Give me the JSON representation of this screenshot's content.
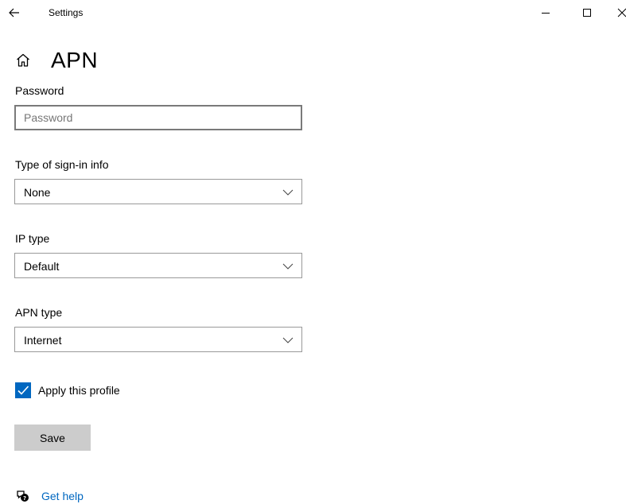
{
  "window": {
    "title": "Settings",
    "back_icon": "arrow-left-icon",
    "minimize_icon": "minimize-icon",
    "maximize_icon": "maximize-icon",
    "close_icon": "close-icon"
  },
  "header": {
    "home_icon": "home-icon",
    "title": "APN"
  },
  "form": {
    "password": {
      "label": "Password",
      "placeholder": "Password",
      "value": ""
    },
    "sign_in_type": {
      "label": "Type of sign-in info",
      "value": "None"
    },
    "ip_type": {
      "label": "IP type",
      "value": "Default"
    },
    "apn_type": {
      "label": "APN type",
      "value": "Internet"
    },
    "apply_profile": {
      "label": "Apply this profile",
      "checked": true
    },
    "save_label": "Save"
  },
  "help": {
    "icon": "help-chat-icon",
    "label": "Get help"
  },
  "colors": {
    "accent": "#0067c0",
    "button_bg": "#cccccc",
    "input_border": "#7a7a7a"
  }
}
